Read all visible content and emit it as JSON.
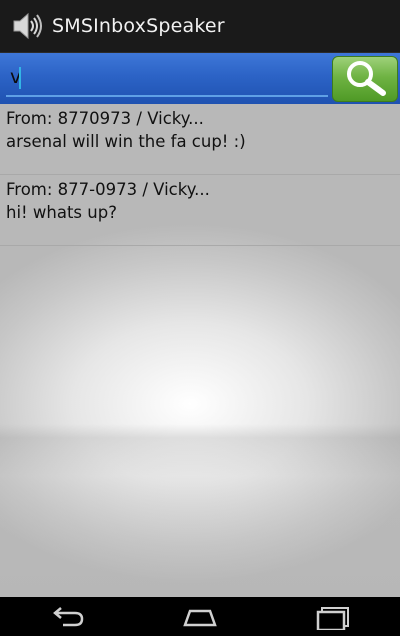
{
  "app": {
    "title": "SMSInboxSpeaker",
    "icon": "speaker-icon"
  },
  "search": {
    "value": "v",
    "button_icon": "magnifier-icon",
    "colors": {
      "bar": "#2c63c6",
      "button": "#6fb343"
    }
  },
  "messages": [
    {
      "from": "From:  8770973 / Vicky...",
      "body": "arsenal will win the fa cup! :)"
    },
    {
      "from": "From:  877-0973 / Vicky...",
      "body": "hi! whats up?"
    }
  ],
  "navbar": {
    "buttons": [
      "back-icon",
      "home-icon",
      "recent-apps-icon"
    ]
  }
}
